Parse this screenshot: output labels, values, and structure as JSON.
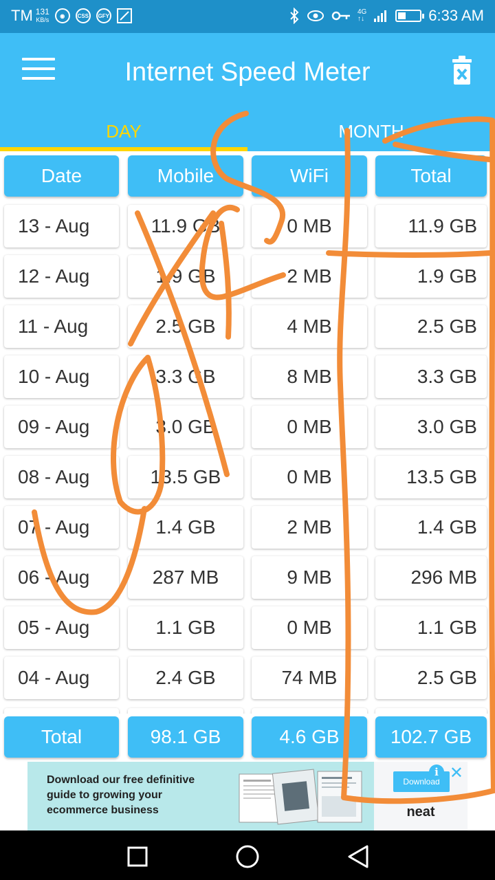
{
  "status_bar": {
    "carrier": "TM",
    "speed_value": "131",
    "speed_unit": "KB/s",
    "app_icons": [
      "CSS",
      "GFY"
    ],
    "network": "4G",
    "time": "6:33 AM",
    "battery_level": 0.35
  },
  "app": {
    "title": "Internet Speed Meter",
    "tabs": [
      {
        "label": "DAY",
        "selected": true
      },
      {
        "label": "MONTH",
        "selected": false
      }
    ],
    "accent_color": "#3fbef6",
    "tab_indicator_color": "#ffd600"
  },
  "table": {
    "headers": [
      "Date",
      "Mobile",
      "WiFi",
      "Total"
    ],
    "rows": [
      {
        "date": "13 - Aug",
        "mobile": "11.9 GB",
        "wifi": "0 MB",
        "total": "11.9 GB"
      },
      {
        "date": "12 - Aug",
        "mobile": "1.9 GB",
        "wifi": "2 MB",
        "total": "1.9 GB"
      },
      {
        "date": "11 - Aug",
        "mobile": "2.5 GB",
        "wifi": "4 MB",
        "total": "2.5 GB"
      },
      {
        "date": "10 - Aug",
        "mobile": "3.3 GB",
        "wifi": "8 MB",
        "total": "3.3 GB"
      },
      {
        "date": "09 - Aug",
        "mobile": "3.0 GB",
        "wifi": "0 MB",
        "total": "3.0 GB"
      },
      {
        "date": "08 - Aug",
        "mobile": "13.5 GB",
        "wifi": "0 MB",
        "total": "13.5 GB"
      },
      {
        "date": "07 - Aug",
        "mobile": "1.4 GB",
        "wifi": "2 MB",
        "total": "1.4 GB"
      },
      {
        "date": "06 - Aug",
        "mobile": "287 MB",
        "wifi": "9 MB",
        "total": "296 MB"
      },
      {
        "date": "05 - Aug",
        "mobile": "1.1 GB",
        "wifi": "0 MB",
        "total": "1.1 GB"
      },
      {
        "date": "04 - Aug",
        "mobile": "2.4 GB",
        "wifi": "74 MB",
        "total": "2.5 GB"
      }
    ],
    "totals": {
      "label": "Total",
      "mobile": "98.1 GB",
      "wifi": "4.6 GB",
      "total": "102.7 GB"
    }
  },
  "ad": {
    "text": "Download our free definitive guide to growing your ecommerce business",
    "button": "Download",
    "brand": "neat",
    "info_glyph": "i",
    "close_glyph": "✕"
  },
  "annotation": {
    "stroke_color": "#f28c38"
  }
}
